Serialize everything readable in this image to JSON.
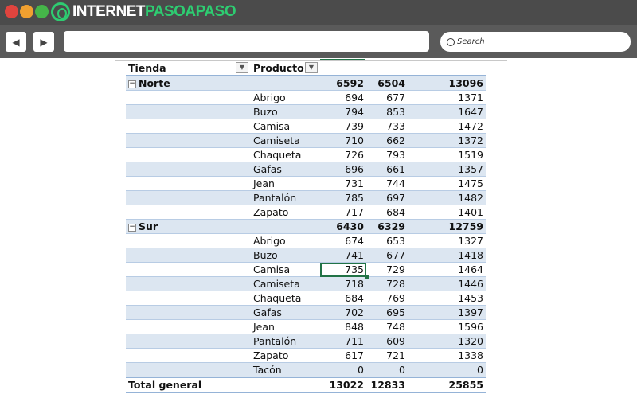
{
  "window": {
    "traffic_lights": {
      "close": "#e0443e",
      "minimize": "#f0a030",
      "maximize": "#45b549"
    },
    "logo": {
      "part1": "INTERNET",
      "part2": "PASOAPASO"
    },
    "accent": "#2ecc71"
  },
  "toolbar": {
    "back_icon": "triangle-left",
    "forward_icon": "triangle-right",
    "url_value": "",
    "search_placeholder": "Search"
  },
  "pivot": {
    "headers": {
      "tienda": "Tienda",
      "producto": "Producto"
    },
    "groups": [
      {
        "name": "Norte",
        "totals": [
          6592,
          6504,
          13096
        ],
        "rows": [
          [
            "Abrigo",
            694,
            677,
            1371
          ],
          [
            "Buzo",
            794,
            853,
            1647
          ],
          [
            "Camisa",
            739,
            733,
            1472
          ],
          [
            "Camiseta",
            710,
            662,
            1372
          ],
          [
            "Chaqueta",
            726,
            793,
            1519
          ],
          [
            "Gafas",
            696,
            661,
            1357
          ],
          [
            "Jean",
            731,
            744,
            1475
          ],
          [
            "Pantalón",
            785,
            697,
            1482
          ],
          [
            "Zapato",
            717,
            684,
            1401
          ]
        ]
      },
      {
        "name": "Sur",
        "totals": [
          6430,
          6329,
          12759
        ],
        "rows": [
          [
            "Abrigo",
            674,
            653,
            1327
          ],
          [
            "Buzo",
            741,
            677,
            1418
          ],
          [
            "Camisa",
            735,
            729,
            1464
          ],
          [
            "Camiseta",
            718,
            728,
            1446
          ],
          [
            "Chaqueta",
            684,
            769,
            1453
          ],
          [
            "Gafas",
            702,
            695,
            1397
          ],
          [
            "Jean",
            848,
            748,
            1596
          ],
          [
            "Pantalón",
            711,
            609,
            1320
          ],
          [
            "Zapato",
            617,
            721,
            1338
          ],
          [
            "Tacón",
            0,
            0,
            0
          ]
        ]
      }
    ],
    "grand_total": {
      "label": "Total general",
      "values": [
        13022,
        12833,
        25855
      ]
    },
    "selected_cell": {
      "group": "Sur",
      "product": "Camisa",
      "value": 735
    },
    "colors": {
      "band": "#dce6f1",
      "selection": "#217346"
    }
  }
}
